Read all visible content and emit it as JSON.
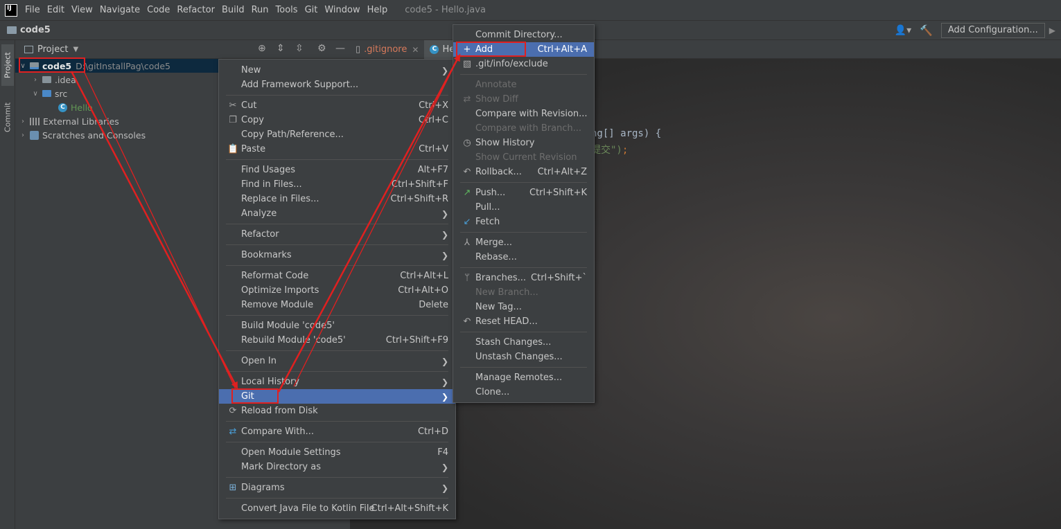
{
  "menubar": {
    "logo": "IJ",
    "items": [
      "File",
      "Edit",
      "View",
      "Navigate",
      "Code",
      "Refactor",
      "Build",
      "Run",
      "Tools",
      "Git",
      "Window",
      "Help"
    ],
    "window_title": "code5 - Hello.java"
  },
  "navbar": {
    "crumb": "code5",
    "add_config": "Add Configuration..."
  },
  "stripe": {
    "project": "Project",
    "commit": "Commit"
  },
  "project_panel": {
    "title": "Project",
    "tree": {
      "root_name": "code5",
      "root_path": "D:\\gitInstallPag\\code5",
      "idea": ".idea",
      "src": "src",
      "hello": "Hello",
      "ext_libs": "External Libraries",
      "scratches": "Scratches and Consoles"
    }
  },
  "editor": {
    "tab_gitignore": ".gitignore",
    "tab_hello": "He",
    "code_line_1": "ng[] args) {",
    "code_line_2_str": "提交\")",
    "code_line_2_end": ";"
  },
  "context_menu": {
    "new": "New",
    "add_framework": "Add Framework Support...",
    "cut": "Cut",
    "cut_sc": "Ctrl+X",
    "copy": "Copy",
    "copy_sc": "Ctrl+C",
    "copy_path": "Copy Path/Reference...",
    "paste": "Paste",
    "paste_sc": "Ctrl+V",
    "find_usages": "Find Usages",
    "find_usages_sc": "Alt+F7",
    "find_in_files": "Find in Files...",
    "find_in_files_sc": "Ctrl+Shift+F",
    "replace_in_files": "Replace in Files...",
    "replace_in_files_sc": "Ctrl+Shift+R",
    "analyze": "Analyze",
    "refactor": "Refactor",
    "bookmarks": "Bookmarks",
    "reformat": "Reformat Code",
    "reformat_sc": "Ctrl+Alt+L",
    "optimize": "Optimize Imports",
    "optimize_sc": "Ctrl+Alt+O",
    "remove_module": "Remove Module",
    "remove_module_sc": "Delete",
    "build_module": "Build Module 'code5'",
    "rebuild_module": "Rebuild Module 'code5'",
    "rebuild_module_sc": "Ctrl+Shift+F9",
    "open_in": "Open In",
    "local_history": "Local History",
    "git": "Git",
    "reload": "Reload from Disk",
    "compare_with": "Compare With...",
    "compare_with_sc": "Ctrl+D",
    "module_settings": "Open Module Settings",
    "module_settings_sc": "F4",
    "mark_dir": "Mark Directory as",
    "diagrams": "Diagrams",
    "convert": "Convert Java File to Kotlin File",
    "convert_sc": "Ctrl+Alt+Shift+K"
  },
  "git_submenu": {
    "commit_dir": "Commit Directory...",
    "add": "Add",
    "add_sc": "Ctrl+Alt+A",
    "exclude": ".git/info/exclude",
    "annotate": "Annotate",
    "show_diff": "Show Diff",
    "compare_revision": "Compare with Revision...",
    "compare_branch": "Compare with Branch...",
    "show_history": "Show History",
    "show_current_rev": "Show Current Revision",
    "rollback": "Rollback...",
    "rollback_sc": "Ctrl+Alt+Z",
    "push": "Push...",
    "push_sc": "Ctrl+Shift+K",
    "pull": "Pull...",
    "fetch": "Fetch",
    "merge": "Merge...",
    "rebase": "Rebase...",
    "branches": "Branches...",
    "branches_sc": "Ctrl+Shift+`",
    "new_branch": "New Branch...",
    "new_tag": "New Tag...",
    "reset_head": "Reset HEAD...",
    "stash": "Stash Changes...",
    "unstash": "Unstash Changes...",
    "manage_remotes": "Manage Remotes...",
    "clone": "Clone..."
  },
  "colors": {
    "highlight": "#4b6eaf",
    "annotation": "#e02020",
    "menu_bg": "#3c3f41"
  }
}
